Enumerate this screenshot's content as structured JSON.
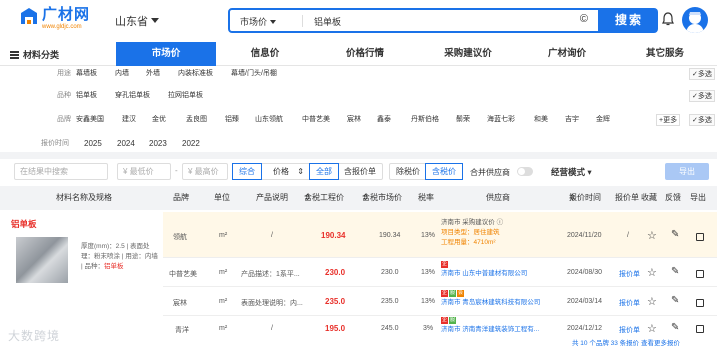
{
  "header": {
    "logo_name": "广材网",
    "logo_url": "www.gldjc.com",
    "province": "山东省",
    "search_type": "市场价",
    "search_query": "铝单板",
    "search_button": "搜索"
  },
  "nav": {
    "category": "材料分类",
    "items": [
      "市场价",
      "信息价",
      "价格行情",
      "采购建议价",
      "广材询价",
      "其它服务"
    ]
  },
  "filters": {
    "use": {
      "label": "用途",
      "options": [
        "幕墙板",
        "内墙",
        "外墙",
        "内装标准板",
        "幕墙/门头/吊棚"
      ],
      "multi": "多选"
    },
    "product": {
      "label": "品种",
      "options": [
        "铝单板",
        "穿孔铝单板",
        "拉网铝单板"
      ],
      "multi": "多选"
    },
    "brand": {
      "label": "品牌",
      "options": [
        "安鑫美国",
        "建汉",
        "金优",
        "孟良图",
        "铝臻",
        "山东领航",
        "中普艺美",
        "宸林",
        "鑫泰",
        "丹斯伯格",
        "鬃荣",
        "海蓝七彩",
        "和美",
        "吉宇",
        "金辉"
      ],
      "more": "更多",
      "multi": "多选"
    },
    "years": {
      "label": "报价时间",
      "options": [
        "2025",
        "2024",
        "2023",
        "2022"
      ]
    }
  },
  "toolbar": {
    "search_placeholder": "在结果中搜索",
    "min_price": "最低价",
    "max_price": "最高价",
    "sort": [
      "综合",
      "价格"
    ],
    "scope": [
      "全部",
      "含报价单"
    ],
    "tax": [
      "除税价",
      "含税价"
    ],
    "merge_suppliers": "合并供应商",
    "mode": "经营模式",
    "export": "导出"
  },
  "table": {
    "headers": [
      "材料名称及规格",
      "品牌",
      "单位",
      "产品说明",
      "含税工程价",
      "含税市场价",
      "税率",
      "供应商",
      "报价时间",
      "报价单",
      "收藏",
      "反馈",
      "导出"
    ],
    "product": {
      "name": "铝单板",
      "thickness": "厚度(mm)：2.5",
      "surface": "表面处理：粉末喷涂",
      "usage": "用途：内墙",
      "variety_label": "品种：",
      "variety": "铝单板"
    },
    "rows": [
      {
        "brand": "领航",
        "unit": "m²",
        "desc": "/",
        "eng_price": "190.34",
        "mkt_price": "190.34",
        "tax": "13%",
        "supplier": "济南市 采购建议价",
        "project_type": "项目类型：居住建筑",
        "project_qty": "工程用量：4710m²",
        "date": "2024/11/20",
        "quote": "/"
      },
      {
        "brand": "中普艺美",
        "unit": "m²",
        "desc": "产品描述：1系平...",
        "eng_price": "230.0",
        "mkt_price": "230.0",
        "tax": "13%",
        "supplier": "济南市 山东中普建材有限公司",
        "date": "2024/08/30",
        "quote": "报价单"
      },
      {
        "brand": "宸林",
        "unit": "m²",
        "desc": "表面处理说明：内...",
        "eng_price": "235.0",
        "mkt_price": "235.0",
        "tax": "13%",
        "supplier": "济南市 青岛宸林建筑科技有限公司",
        "date": "2024/03/14",
        "quote": "报价单"
      },
      {
        "brand": "青洋",
        "unit": "m²",
        "desc": "/",
        "eng_price": "195.0",
        "mkt_price": "245.0",
        "tax": "3%",
        "supplier": "济南市 济南青洋建筑装饰工程有...",
        "date": "2024/12/12",
        "quote": "报价单"
      }
    ],
    "footer": "共 10 个品牌 33 条报价 查看更多报价"
  },
  "watermark": "大数跨境",
  "colors": {
    "brand_blue": "#1a72e8",
    "price_red": "#e8302a",
    "highlight_row": "#fff8e8"
  }
}
